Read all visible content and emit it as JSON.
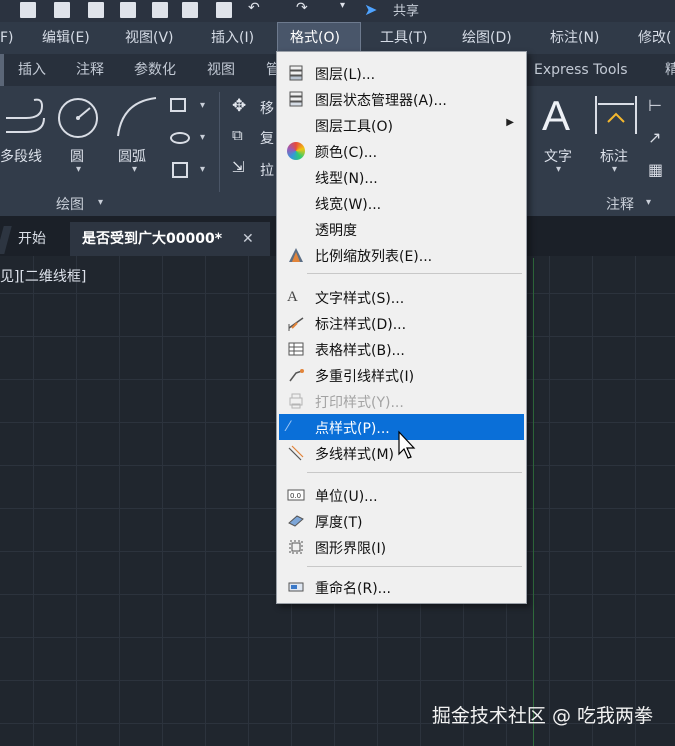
{
  "quick_access": {
    "share_label": "共享",
    "share_icon": "send-icon"
  },
  "menubar": {
    "items": [
      {
        "label": "F)"
      },
      {
        "label": "编辑(E)"
      },
      {
        "label": "视图(V)"
      },
      {
        "label": "插入(I)"
      },
      {
        "label": "格式(O)"
      },
      {
        "label": "工具(T)"
      },
      {
        "label": "绘图(D)"
      },
      {
        "label": "标注(N)"
      },
      {
        "label": "修改("
      }
    ],
    "active_index": 4
  },
  "ribbon_tabs": [
    "插入",
    "注释",
    "参数化",
    "视图",
    "管",
    "Express Tools",
    "精"
  ],
  "ribbon": {
    "draw_tools": [
      "多段线",
      "圆",
      "圆弧"
    ],
    "draw_panel_title": "绘图",
    "modify_partial": [
      "移",
      "复",
      "拉"
    ],
    "annotation_tools": [
      "文字",
      "标注"
    ],
    "annotation_panel_title": "注释"
  },
  "doc_tabs": {
    "start": "开始",
    "active": "是否受到广大00000*",
    "close_icon": "close-icon"
  },
  "viewport_label": "见][二维线框]",
  "watermark": "掘金技术社区 @ 吃我两拳",
  "dropdown": {
    "items": [
      {
        "label": "图层(L)...",
        "icon": "layer-icon"
      },
      {
        "label": "图层状态管理器(A)...",
        "icon": "layer-state-icon"
      },
      {
        "label": "图层工具(O)",
        "icon": "",
        "submenu": true
      },
      {
        "label": "颜色(C)...",
        "icon": "color-wheel-icon"
      },
      {
        "label": "线型(N)...",
        "icon": ""
      },
      {
        "label": "线宽(W)...",
        "icon": ""
      },
      {
        "label": "透明度",
        "icon": ""
      },
      {
        "label": "比例缩放列表(E)...",
        "icon": "scale-list-icon"
      },
      {
        "label": "文字样式(S)...",
        "icon": "text-style-icon"
      },
      {
        "label": "标注样式(D)...",
        "icon": "dim-style-icon"
      },
      {
        "label": "表格样式(B)...",
        "icon": "table-style-icon"
      },
      {
        "label": "多重引线样式(I)",
        "icon": "multileader-style-icon"
      },
      {
        "label": "打印样式(Y)...",
        "icon": "plot-style-icon",
        "disabled": true
      },
      {
        "label": "点样式(P)...",
        "icon": "point-style-icon",
        "highlighted": true
      },
      {
        "label": "多线样式(M)",
        "icon": "multiline-style-icon"
      },
      {
        "label": "单位(U)...",
        "icon": "units-icon"
      },
      {
        "label": "厚度(T)",
        "icon": "thickness-icon"
      },
      {
        "label": "图形界限(I)",
        "icon": "drawing-limits-icon"
      },
      {
        "label": "重命名(R)...",
        "icon": "rename-icon"
      }
    ]
  },
  "colors": {
    "highlight": "#0a6fd8",
    "menu_bg": "#f0f0f0",
    "canvas_bg": "#20262e"
  }
}
